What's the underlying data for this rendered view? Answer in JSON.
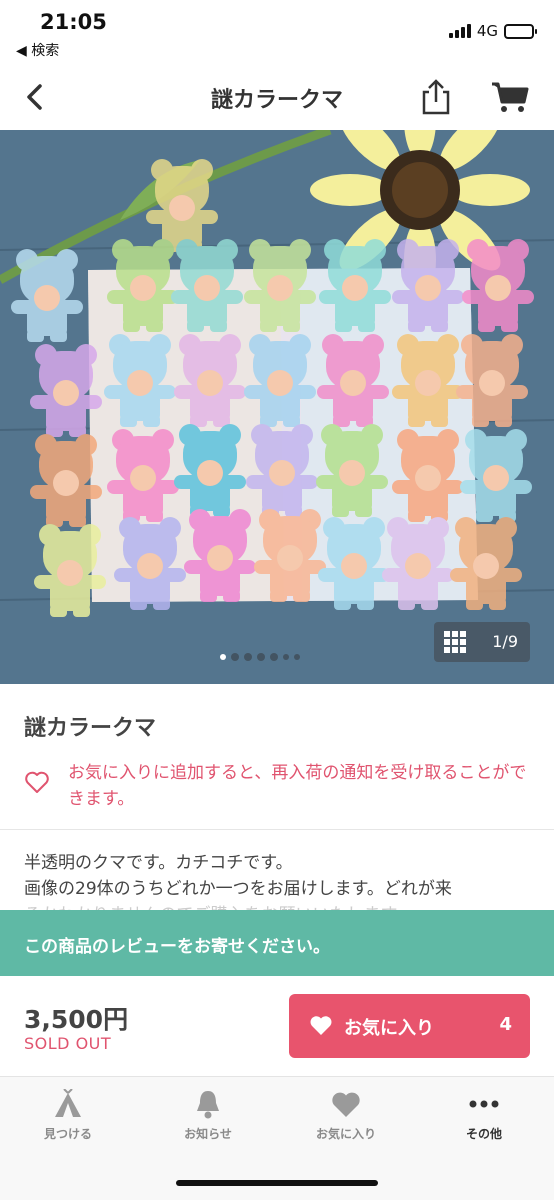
{
  "status_bar": {
    "time": "21:05",
    "back_app": "◀ 検索",
    "network": "4G"
  },
  "nav": {
    "title": "謎カラークマ",
    "icons": [
      "back-chevron-icon",
      "share-icon",
      "cart-icon"
    ]
  },
  "gallery": {
    "counter": "1/9",
    "page_index": 1,
    "page_dots": 7
  },
  "product": {
    "name": "謎カラークマ",
    "favorite_note": "お気に入りに追加すると、再入荷の通知を受け取ることができます。",
    "description_line1": "半透明のクマです。カチコチです。",
    "description_line2": "画像の29体のうちどれか一つをお届けします。どれが来",
    "description_line3_faded": "るかわかりませんのでご購入をお願いいたします。"
  },
  "review_banner": {
    "text": "この商品のレビューをお寄せください。"
  },
  "purchase": {
    "price": "3,500円",
    "status": "SOLD OUT",
    "favorite_label": "お気に入り",
    "favorite_count": "4"
  },
  "tabs": [
    {
      "label": "見つける",
      "icon": "tent-icon"
    },
    {
      "label": "お知らせ",
      "icon": "bell-icon"
    },
    {
      "label": "お気に入り",
      "icon": "heart-icon"
    },
    {
      "label": "その他",
      "icon": "more-icon"
    }
  ],
  "colors": {
    "accent_pink": "#e8546d",
    "teal_banner": "#5fb9a5"
  }
}
